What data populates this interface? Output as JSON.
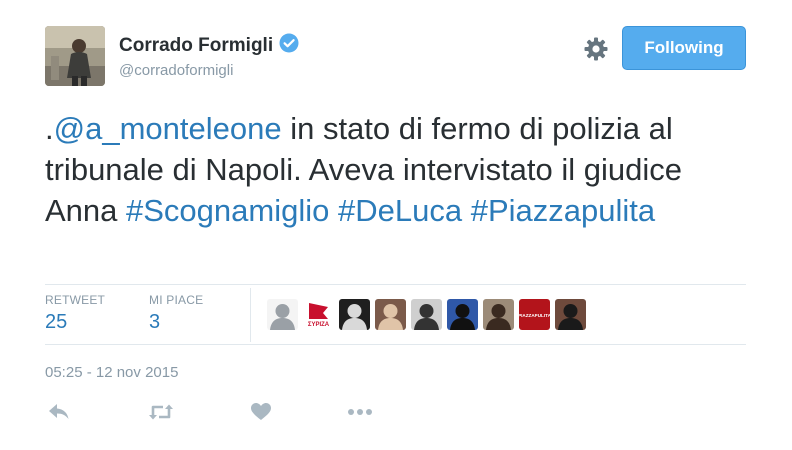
{
  "author": {
    "name": "Corrado Formigli",
    "handle": "@corradoformigli"
  },
  "follow_button": {
    "label": "Following"
  },
  "tweet": {
    "segments": [
      {
        "text": ".",
        "link": false
      },
      {
        "text": "@a_monteleone",
        "link": true
      },
      {
        "text": " in stato di fermo di polizia al tribunale di Napoli. Aveva intervistato il giudice Anna ",
        "link": false
      },
      {
        "text": "#Scognamiglio",
        "link": true
      },
      {
        "text": " ",
        "link": false
      },
      {
        "text": "#DeLuca",
        "link": true
      },
      {
        "text": " ",
        "link": false
      },
      {
        "text": "#Piazzapulita",
        "link": true
      }
    ]
  },
  "stats": {
    "retweets": {
      "label": "RETWEET",
      "value": "25"
    },
    "likes": {
      "label": "MI PIACE",
      "value": "3"
    }
  },
  "avatars": [
    {
      "name": "favoriter-avatar-1",
      "text": "",
      "bg": "#f4f4f4",
      "fg": "#9aa0a6"
    },
    {
      "name": "favoriter-avatar-2",
      "text": "ΣΥΡΙΖΑ",
      "bg": "#ffffff",
      "fg": "#c8102e"
    },
    {
      "name": "favoriter-avatar-3",
      "text": "",
      "bg": "#1f1f1f",
      "fg": "#d9d9d9"
    },
    {
      "name": "favoriter-avatar-4",
      "text": "",
      "bg": "#7b5a4a",
      "fg": "#e0c4a8"
    },
    {
      "name": "favoriter-avatar-5",
      "text": "",
      "bg": "#cfcfcf",
      "fg": "#333333"
    },
    {
      "name": "favoriter-avatar-6",
      "text": "",
      "bg": "#2f58a8",
      "fg": "#111111"
    },
    {
      "name": "favoriter-avatar-7",
      "text": "",
      "bg": "#9c8b78",
      "fg": "#3a2a20"
    },
    {
      "name": "favoriter-avatar-8",
      "text": "PIAZZAPULITA",
      "bg": "#b3141b",
      "fg": "#ffffff"
    },
    {
      "name": "favoriter-avatar-9",
      "text": "",
      "bg": "#6e4a3c",
      "fg": "#1a1a1a"
    }
  ],
  "timestamp": "05:25 - 12 nov 2015",
  "colors": {
    "accent": "#55acee",
    "link": "#2b7bb9",
    "muted": "#8899a6",
    "action_icons": "#aab8c2"
  },
  "icons": [
    "verified-badge-icon",
    "gear-icon",
    "reply-icon",
    "retweet-icon",
    "like-heart-icon",
    "more-dots-icon"
  ]
}
